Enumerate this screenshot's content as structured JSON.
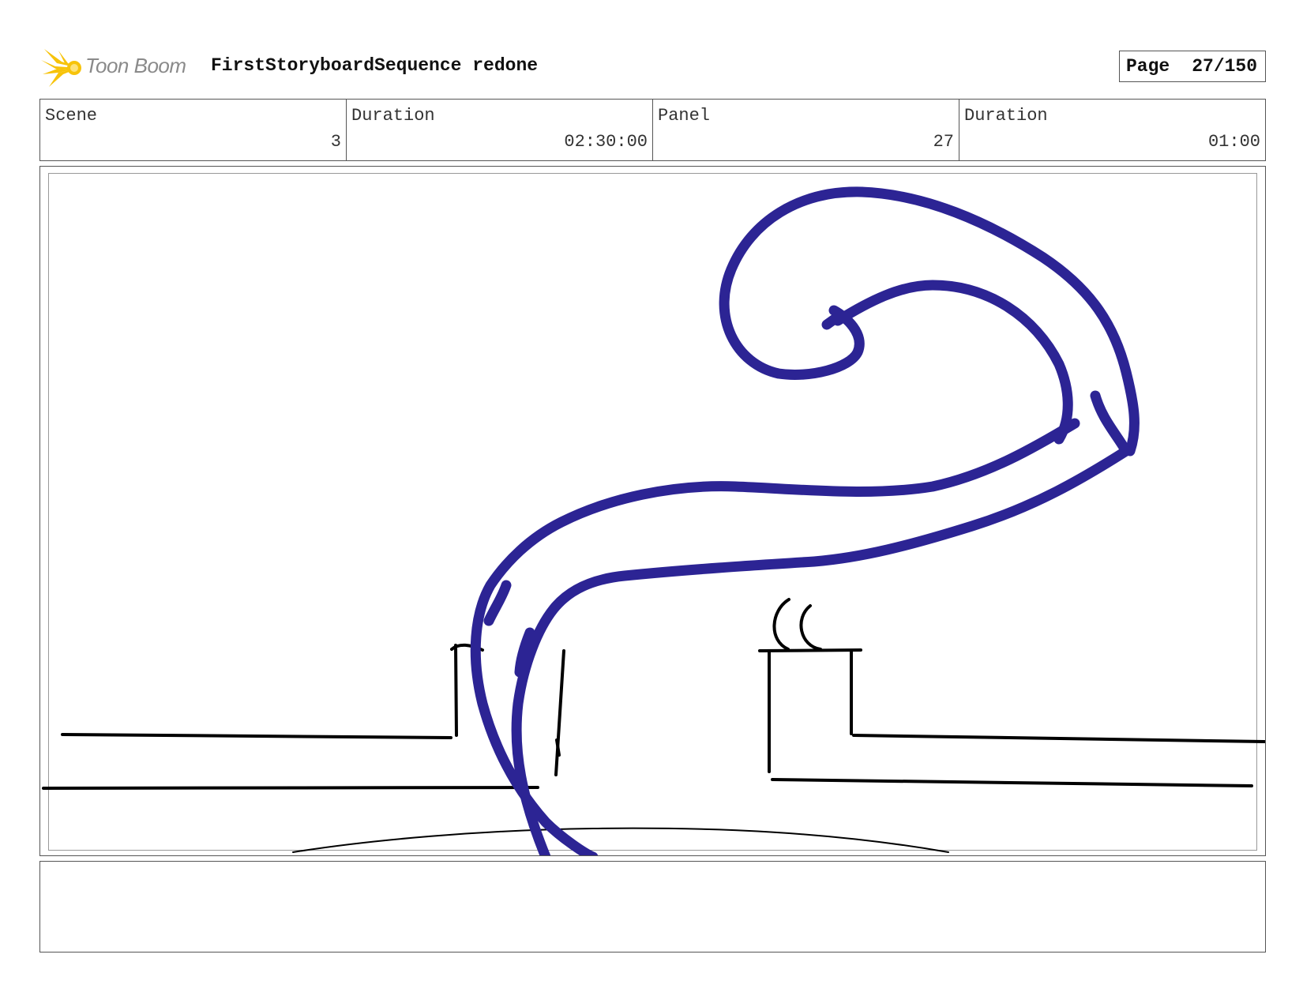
{
  "header": {
    "brand": "Toon Boom",
    "title": "FirstStoryboardSequence redone",
    "page_label": "Page",
    "page_value": "27/150"
  },
  "info": {
    "scene_label": "Scene",
    "scene_value": "3",
    "scene_duration_label": "Duration",
    "scene_duration_value": "02:30:00",
    "panel_label": "Panel",
    "panel_value": "27",
    "panel_duration_label": "Duration",
    "panel_duration_value": "01:00"
  },
  "colors": {
    "tentacle": "#2c2494",
    "ink": "#000000",
    "logo_star": "#f7c30a"
  },
  "notes": {
    "text": ""
  }
}
